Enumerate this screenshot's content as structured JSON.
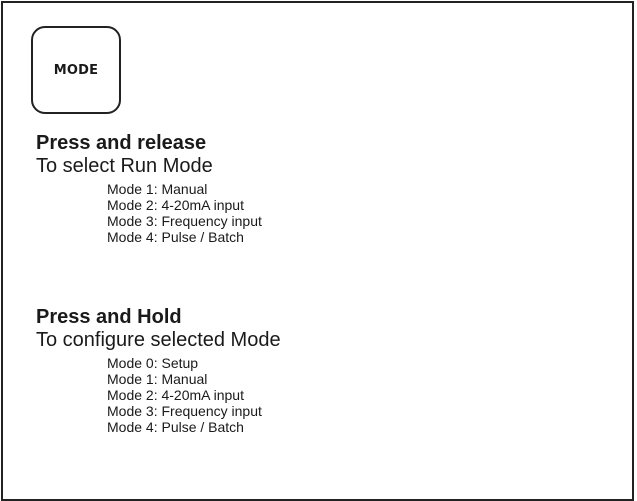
{
  "mode_button": {
    "label": "MODE"
  },
  "press_release": {
    "title": "Press and release",
    "subtitle": "To select Run Mode",
    "modes": [
      "Mode 1: Manual",
      "Mode 2: 4-20mA input",
      "Mode 3: Frequency input",
      "Mode 4: Pulse / Batch"
    ]
  },
  "press_hold": {
    "title": "Press and Hold",
    "subtitle": "To configure selected Mode",
    "modes": [
      "Mode 0: Setup",
      "Mode 1: Manual",
      "Mode 2: 4-20mA input",
      "Mode 3: Frequency input",
      "Mode 4: Pulse / Batch"
    ]
  },
  "colors": {
    "text": "#1a1a1a",
    "border": "#222222",
    "background": "#ffffff"
  }
}
